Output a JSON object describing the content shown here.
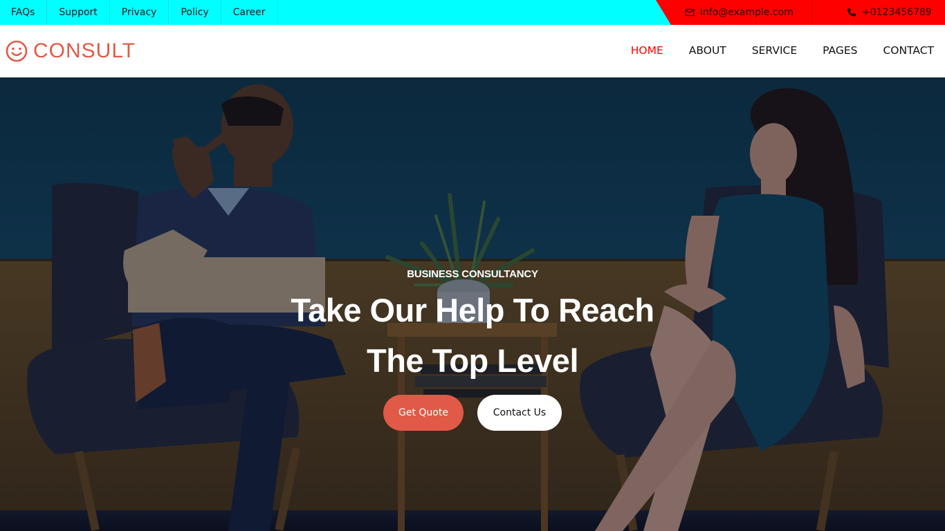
{
  "topbar": {
    "links": [
      {
        "label": "FAQs"
      },
      {
        "label": "Support"
      },
      {
        "label": "Privacy"
      },
      {
        "label": "Policy"
      },
      {
        "label": "Career"
      }
    ],
    "email": {
      "icon": "envelope-icon",
      "text": "info@example.com"
    },
    "phone": {
      "icon": "phone-icon",
      "text": "+0123456789"
    },
    "colors": {
      "background": "#00ffff",
      "contact_background": "#ff0000"
    }
  },
  "navbar": {
    "brand": {
      "icon": "smiley-face-icon",
      "text": "CONSULT",
      "color": "#e05a47"
    },
    "menu": [
      {
        "label": "HOME",
        "active": true
      },
      {
        "label": "ABOUT"
      },
      {
        "label": "SERVICE"
      },
      {
        "label": "PAGES"
      },
      {
        "label": "CONTACT"
      }
    ],
    "active_color": "#ff0000"
  },
  "hero": {
    "eyebrow": "BUSINESS CONSULTANCY",
    "title_line1": "Take Our Help To Reach",
    "title_line2": "The Top Level",
    "primary_button": "Get Quote",
    "secondary_button": "Contact Us",
    "accent_color": "#e05a47"
  }
}
